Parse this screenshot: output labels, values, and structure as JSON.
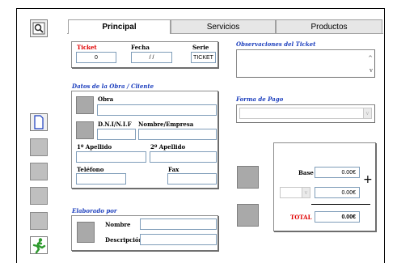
{
  "tabs": [
    {
      "label": "Principal"
    },
    {
      "label": "Servicios"
    },
    {
      "label": "Productos"
    }
  ],
  "ticket": {
    "label": "Ticket",
    "value": "0",
    "label_color": "#e00000"
  },
  "fecha": {
    "label": "Fecha",
    "value": "/ /"
  },
  "serie": {
    "label": "Serie",
    "value": "TICKET"
  },
  "observaciones": {
    "title": "Observaciones del Ticket"
  },
  "obra_cliente": {
    "title": "Datos de la Obra / Cliente",
    "obra_label": "Obra",
    "dni_label": "D.N.I/N.I.F",
    "nombre_empresa_label": "Nombre/Empresa",
    "apellido1_label": "1º Apellido",
    "apellido2_label": "2º Apellido",
    "telefono_label": "Teléfono",
    "fax_label": "Fax"
  },
  "forma_pago": {
    "title": "Forma de Pago"
  },
  "elaborado": {
    "title": "Elaborado por",
    "nombre_label": "Nombre",
    "descripcion_label": "Descripción"
  },
  "totales": {
    "base_label": "Base",
    "base_value": "0.00€",
    "tax_value": "0.00€",
    "plus": "+",
    "total_label": "TOTAL",
    "total_value": "0.00€"
  },
  "colors": {
    "section_title": "#1a3dbd",
    "total_label": "#e00000"
  },
  "icons": {
    "search": "magnifier-icon",
    "new": "new-document-icon",
    "exit": "running-man-icon"
  }
}
